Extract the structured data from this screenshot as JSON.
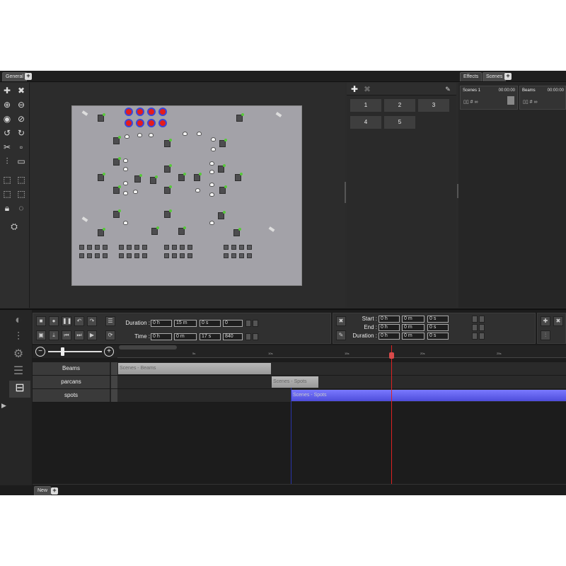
{
  "top_tabs": {
    "general": "General",
    "effects": "Effects",
    "scenes": "Scenes"
  },
  "effects_buttons": [
    "1",
    "2",
    "3",
    "4",
    "5"
  ],
  "scenes_cards": [
    {
      "name": "Scenes 1",
      "time": "00:00:00"
    },
    {
      "name": "Beams",
      "time": "00:00:00"
    }
  ],
  "controls": {
    "duration_label": "Duration :",
    "time_label": "Time :",
    "duration": {
      "h": "0 h",
      "m": "15 m",
      "s": "0 s",
      "f": "0"
    },
    "time": {
      "h": "0 h",
      "m": "0 m",
      "s": "17 s",
      "f": "840"
    }
  },
  "range": {
    "start_label": "Start :",
    "end_label": "End :",
    "duration_label": "Duration :",
    "start": {
      "h": "0 h",
      "m": "0 m",
      "s": "0 s"
    },
    "end": {
      "h": "0 h",
      "m": "0 m",
      "s": "0 s"
    },
    "duration": {
      "h": "0 h",
      "m": "0 m",
      "s": "0 s"
    }
  },
  "ruler_ticks": [
    "5s",
    "10s",
    "15s",
    "20s",
    "25s"
  ],
  "tracks": [
    {
      "name": "Beams",
      "clip": "Scenes - Beams"
    },
    {
      "name": "parcans",
      "clip": "Scenes - Spots"
    },
    {
      "name": "spots",
      "clip": "Scenes - Spots"
    }
  ],
  "bottom_tab": "New",
  "colors": {
    "playhead": "#d22222",
    "spots_clip": "#5d5ce6",
    "beams_clip": "#a8a8a8"
  }
}
